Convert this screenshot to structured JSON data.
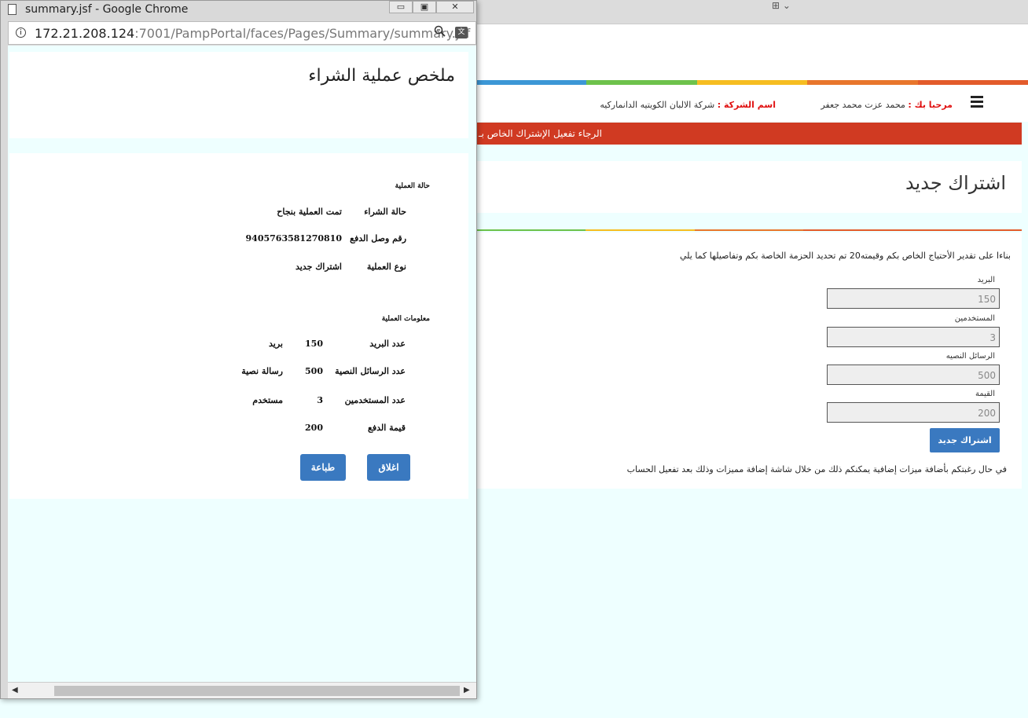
{
  "popup": {
    "window_title": "summary.jsf - Google Chrome",
    "url_host": "172.21.208.124",
    "url_path": ":7001/PampPortal/faces/Pages/Summary/summary.jsf",
    "page_title": "ملخص عملية الشراء",
    "status_section": {
      "heading": "حالة العملية",
      "rows": [
        {
          "label": "حالة الشراء",
          "value": "تمت العملية بنجاح"
        },
        {
          "label": "رقم وصل الدفع",
          "value": "9405763581270810"
        },
        {
          "label": "نوع العملية",
          "value": "اشتراك جديد"
        }
      ]
    },
    "info_section": {
      "heading": "معلومات العملية",
      "rows": [
        {
          "label": "عدد البريد",
          "count": "150",
          "unit": "بريد"
        },
        {
          "label": "عدد الرسائل النصية",
          "count": "500",
          "unit": "رسالة نصية"
        },
        {
          "label": "عدد المستخدمين",
          "count": "3",
          "unit": "مستخدم"
        },
        {
          "label": "قيمة الدفع",
          "count": "200",
          "unit": ""
        }
      ]
    },
    "close_label": "اغلاق",
    "print_label": "طباعة"
  },
  "header": {
    "welcome_label": "مرحبا بك :",
    "user_name": "محمد عزت محمد جعفر",
    "company_label": "اسم الشركة :",
    "company_name": "شركة الالبان الكويتيه الدانماركيه"
  },
  "alert_text": "الرجاء تفعيل الإشتراك الخاص بـ",
  "subscription": {
    "title": "اشتراك جديد",
    "intro": "بناءا على تقدير الأحتياج الخاص بكم وقيمته20 تم تحديد الحزمة الخاصة بكم وتفاصيلها كما يلي",
    "fields": [
      {
        "label": "البريد",
        "value": "150"
      },
      {
        "label": "المستخدمين",
        "value": "3"
      },
      {
        "label": "الرسائل النصيه",
        "value": "500"
      },
      {
        "label": "القيمة",
        "value": "200"
      }
    ],
    "button_label": "اشتراك جديد",
    "footnote": "في حال رغبتكم بأضافة ميزات إضافية يمكنكم ذلك من خلال شاشة إضافة مميزات وذلك بعد تفعيل الحساب"
  },
  "colors": {
    "accent_bar": [
      "#3c97d6",
      "#6dc24b",
      "#f6bd21",
      "#e8762c",
      "#e35b2b"
    ],
    "alert_bg": "#d03a22",
    "button_bg": "#3a79c0",
    "page_bg": "#eeffff"
  }
}
